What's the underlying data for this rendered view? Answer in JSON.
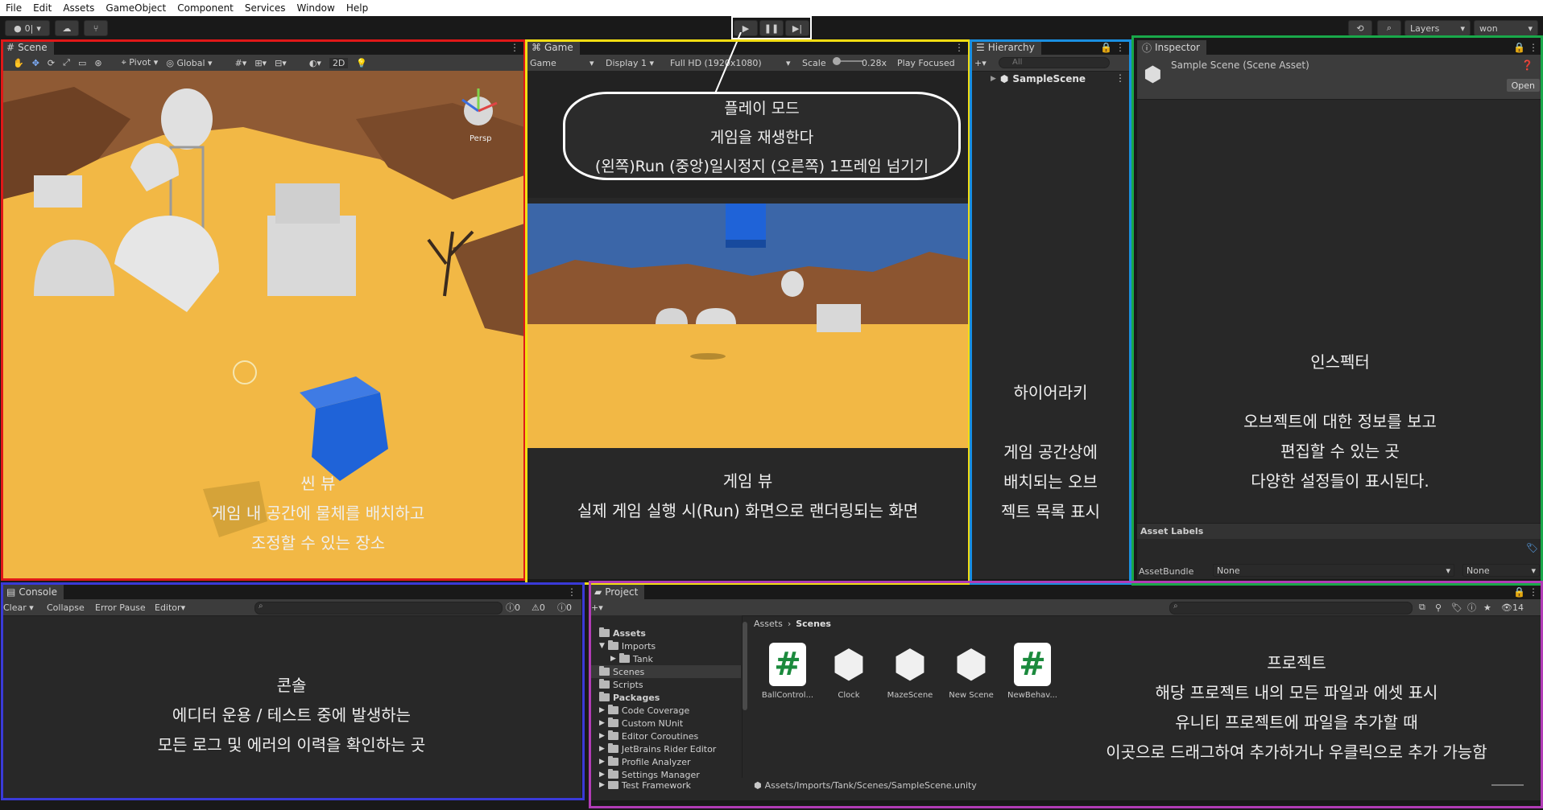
{
  "menu": [
    "File",
    "Edit",
    "Assets",
    "GameObject",
    "Component",
    "Services",
    "Window",
    "Help"
  ],
  "toolbar": {
    "account": "0|",
    "layers": "Layers",
    "layout": "won"
  },
  "scene": {
    "tab": "Scene",
    "pivot": "Pivot",
    "global": "Global",
    "mode2d": "2D",
    "persp": "Persp",
    "caption": [
      "씬 뷰",
      "게임 내 공간에 물체를 배치하고",
      "조정할 수 있는 장소"
    ]
  },
  "game": {
    "tab": "Game",
    "mode": "Game",
    "display": "Display 1",
    "resolution": "Full HD (1920x1080)",
    "scale_label": "Scale",
    "scale_value": "0.28x",
    "play_focused": "Play Focused",
    "play_callout": [
      "플레이 모드",
      "게임을 재생한다",
      "(왼쪽)Run (중앙)일시정지 (오른쪽) 1프레임 넘기기"
    ],
    "caption": [
      "게임 뷰",
      "실제 게임 실행 시(Run) 화면으로 랜더링되는 화면"
    ]
  },
  "hierarchy": {
    "tab": "Hierarchy",
    "search_placeholder": "All",
    "scene_item": "SampleScene",
    "caption": [
      "하이어라키",
      "",
      "게임 공간상에",
      "배치되는 오브",
      "젝트 목록 표시"
    ]
  },
  "inspector": {
    "tab": "Inspector",
    "title": "Sample Scene (Scene Asset)",
    "open_button": "Open",
    "asset_labels": "Asset Labels",
    "assetbundle_label": "AssetBundle",
    "assetbundle_value": "None",
    "assetbundle_variant": "None",
    "caption": [
      "인스펙터",
      "",
      "오브젝트에 대한 정보를 보고",
      "편집할 수 있는 곳",
      "다양한 설정들이 표시된다."
    ]
  },
  "console": {
    "tab": "Console",
    "clear": "Clear",
    "collapse": "Collapse",
    "error_pause": "Error Pause",
    "editor": "Editor",
    "count_logs": "0",
    "count_warnings": "0",
    "count_errors": "0",
    "caption": [
      "콘솔",
      "에디터 운용 / 테스트 중에 발생하는",
      "모든 로그 및 에러의 이력을 확인하는 곳"
    ]
  },
  "project": {
    "tab": "Project",
    "breadcrumb": [
      "Assets",
      "Scenes"
    ],
    "tree": [
      {
        "label": "Assets",
        "bold": true
      },
      {
        "label": "Imports"
      },
      {
        "label": "Tank"
      },
      {
        "label": "Scenes",
        "selected": true
      },
      {
        "label": "Scripts"
      },
      {
        "label": "Packages",
        "bold": true
      },
      {
        "label": "Code Coverage"
      },
      {
        "label": "Custom NUnit"
      },
      {
        "label": "Editor Coroutines"
      },
      {
        "label": "JetBrains Rider Editor"
      },
      {
        "label": "Profile Analyzer"
      },
      {
        "label": "Settings Manager"
      },
      {
        "label": "Test Framework"
      }
    ],
    "assets": [
      {
        "label": "BallControl...",
        "kind": "script"
      },
      {
        "label": "Clock",
        "kind": "unity"
      },
      {
        "label": "MazeScene",
        "kind": "unity"
      },
      {
        "label": "New Scene",
        "kind": "unity"
      },
      {
        "label": "NewBehav...",
        "kind": "script"
      }
    ],
    "hidden_count": "14",
    "path": "Assets/Imports/Tank/Scenes/SampleScene.unity",
    "caption": [
      "프로젝트",
      "해당 프로젝트 내의 모든 파일과 에셋 표시",
      "유니티 프로젝트에 파일을 추가할 때",
      "이곳으로 드래그하여 추가하거나 우클릭으로 추가 가능함"
    ]
  },
  "colors": {
    "scene_frame": "#e01818",
    "game_frame": "#f2dd12",
    "hierarchy_frame": "#1a8fe0",
    "inspector_frame": "#19a84a",
    "console_frame": "#3a3ad8",
    "project_frame": "#b13cb6",
    "sand": "#f2b845",
    "cube": "#1f63d8"
  }
}
